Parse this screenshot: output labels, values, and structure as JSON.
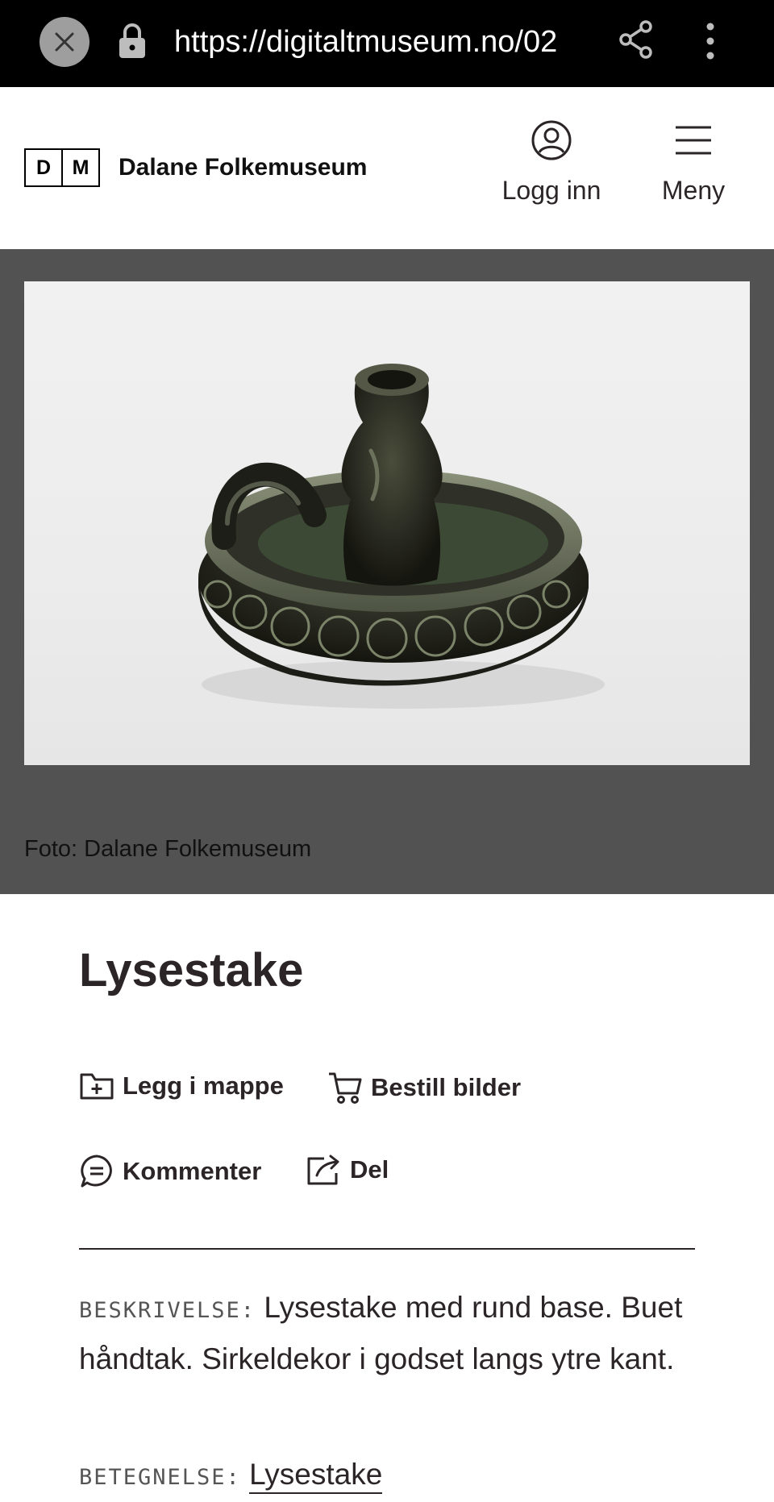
{
  "browser": {
    "url": "https://digitaltmuseum.no/02"
  },
  "header": {
    "logo_left": "D",
    "logo_right": "M",
    "museum_name": "Dalane Folkemuseum",
    "login_label": "Logg inn",
    "menu_label": "Meny"
  },
  "image": {
    "credit": "Foto: Dalane Folkemuseum"
  },
  "object": {
    "title": "Lysestake",
    "actions": {
      "add_to_folder": "Legg i mappe",
      "order_images": "Bestill bilder",
      "comment": "Kommenter",
      "share": "Del"
    },
    "description_label": "BESKRIVELSE:",
    "description": "Lysestake med rund base. Buet håndtak. Sirkeldekor i godset langs ytre kant.",
    "designation_label": "BETEGNELSE:",
    "designation": "Lysestake"
  },
  "colors": {
    "browser_bar": "#000000",
    "image_band": "#525252",
    "text": "#2b2528"
  }
}
